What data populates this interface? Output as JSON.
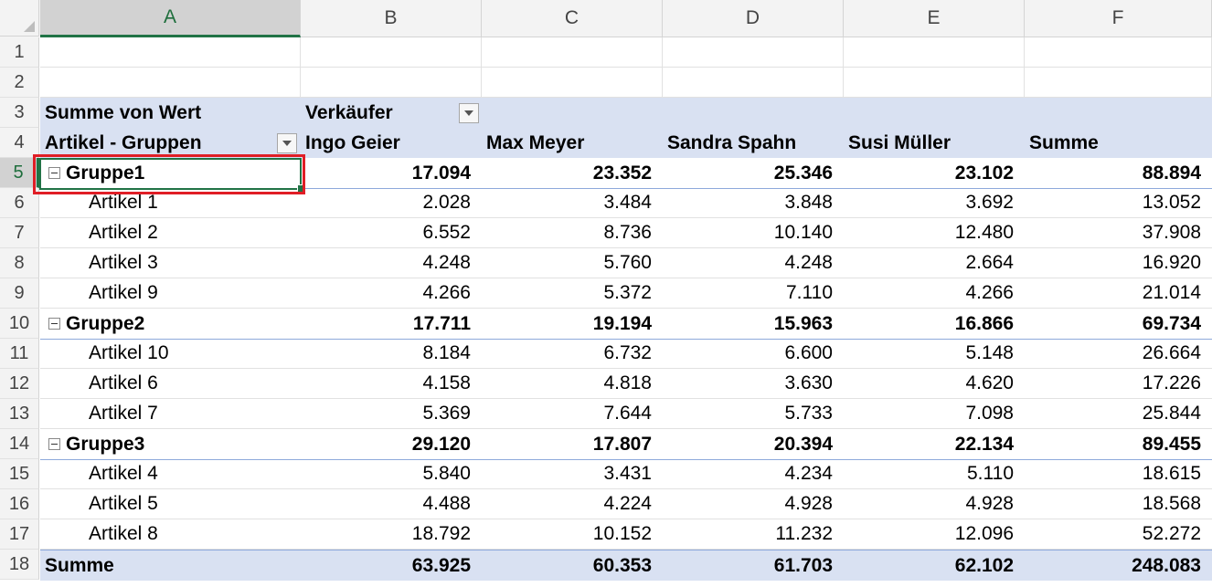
{
  "columns": [
    "A",
    "B",
    "C",
    "D",
    "E",
    "F"
  ],
  "rows_numbers": [
    "1",
    "2",
    "3",
    "4",
    "5",
    "6",
    "7",
    "8",
    "9",
    "10",
    "11",
    "12",
    "13",
    "14",
    "15",
    "16",
    "17",
    "18"
  ],
  "pivot": {
    "value_label": "Summe von Wert",
    "column_field": "Verkäufer",
    "row_field": "Artikel - Gruppen",
    "sellers": [
      "Ingo Geier",
      "Max Meyer",
      "Sandra Spahn",
      "Susi Müller"
    ],
    "total_label": "Summe",
    "groups": [
      {
        "name": "Gruppe1",
        "values": [
          "17.094",
          "23.352",
          "25.346",
          "23.102",
          "88.894"
        ],
        "items": [
          {
            "name": "Artikel 1",
            "values": [
              "2.028",
              "3.484",
              "3.848",
              "3.692",
              "13.052"
            ]
          },
          {
            "name": "Artikel 2",
            "values": [
              "6.552",
              "8.736",
              "10.140",
              "12.480",
              "37.908"
            ]
          },
          {
            "name": "Artikel 3",
            "values": [
              "4.248",
              "5.760",
              "4.248",
              "2.664",
              "16.920"
            ]
          },
          {
            "name": "Artikel 9",
            "values": [
              "4.266",
              "5.372",
              "7.110",
              "4.266",
              "21.014"
            ]
          }
        ]
      },
      {
        "name": "Gruppe2",
        "values": [
          "17.711",
          "19.194",
          "15.963",
          "16.866",
          "69.734"
        ],
        "items": [
          {
            "name": "Artikel 10",
            "values": [
              "8.184",
              "6.732",
              "6.600",
              "5.148",
              "26.664"
            ]
          },
          {
            "name": "Artikel 6",
            "values": [
              "4.158",
              "4.818",
              "3.630",
              "4.620",
              "17.226"
            ]
          },
          {
            "name": "Artikel 7",
            "values": [
              "5.369",
              "7.644",
              "5.733",
              "7.098",
              "25.844"
            ]
          }
        ]
      },
      {
        "name": "Gruppe3",
        "values": [
          "29.120",
          "17.807",
          "20.394",
          "22.134",
          "89.455"
        ],
        "items": [
          {
            "name": "Artikel 4",
            "values": [
              "5.840",
              "3.431",
              "4.234",
              "5.110",
              "18.615"
            ]
          },
          {
            "name": "Artikel 5",
            "values": [
              "4.488",
              "4.224",
              "4.928",
              "4.928",
              "18.568"
            ]
          },
          {
            "name": "Artikel 8",
            "values": [
              "18.792",
              "10.152",
              "11.232",
              "12.096",
              "52.272"
            ]
          }
        ]
      }
    ],
    "grand_total": [
      "63.925",
      "60.353",
      "61.703",
      "62.102",
      "248.083"
    ]
  },
  "selection": {
    "active_column": "A",
    "active_row": "5"
  },
  "colors": {
    "band": "#d9e1f2",
    "accent": "#217346",
    "highlight": "#e01e26"
  },
  "icons": [
    "filter-dropdown-icon",
    "collapse-icon",
    "select-all-icon"
  ]
}
